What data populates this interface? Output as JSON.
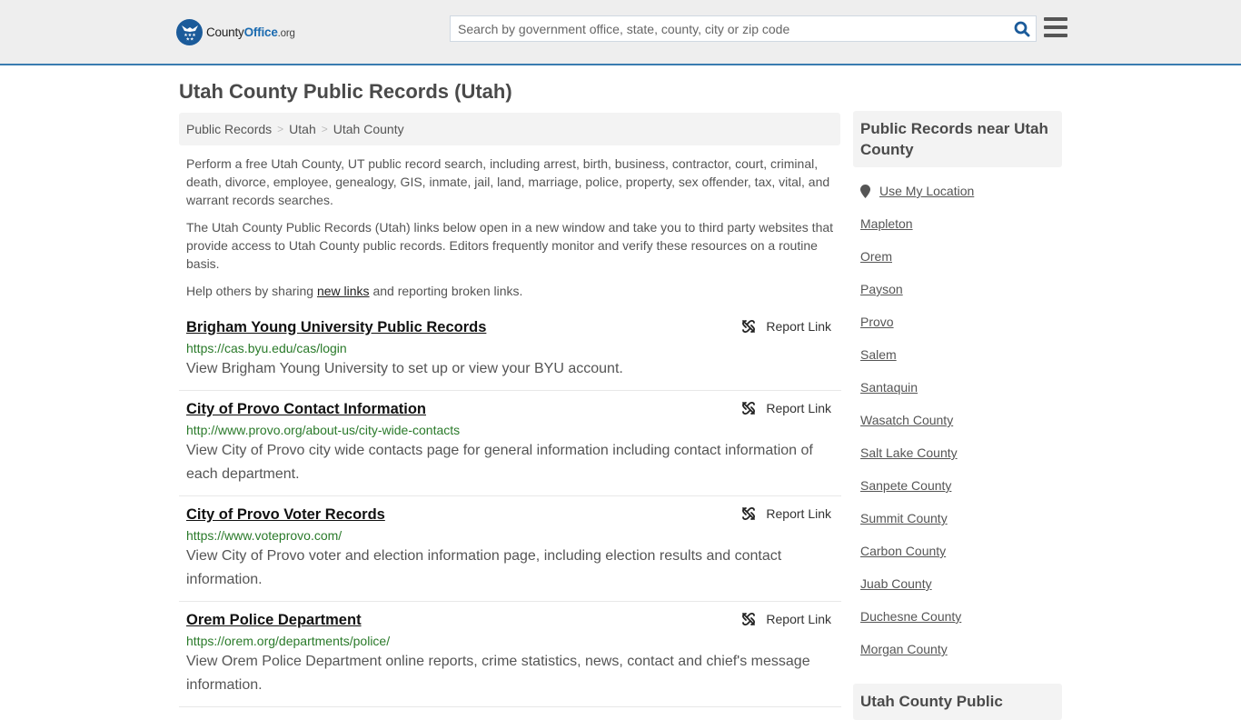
{
  "header": {
    "logo": {
      "name": "County",
      "name_bold": "Office",
      "tld": ".org"
    },
    "search": {
      "placeholder": "Search by government office, state, county, city or zip code",
      "value": ""
    },
    "icons": {
      "search": "search-icon",
      "menu": "hamburger-menu-icon"
    }
  },
  "page": {
    "title": "Utah County Public Records (Utah)"
  },
  "breadcrumb": [
    {
      "label": "Public Records"
    },
    {
      "label": "Utah"
    },
    {
      "label": "Utah County"
    }
  ],
  "intro": {
    "p1": "Perform a free Utah County, UT public record search, including arrest, birth, business, contractor, court, criminal, death, divorce, employee, genealogy, GIS, inmate, jail, land, marriage, police, property, sex offender, tax, vital, and warrant records searches.",
    "p2": "The Utah County Public Records (Utah) links below open in a new window and take you to third party websites that provide access to Utah County public records. Editors frequently monitor and verify these resources on a routine basis.",
    "p3_before": "Help others by sharing ",
    "p3_link": "new links",
    "p3_after": " and reporting broken links."
  },
  "records": [
    {
      "title": "Brigham Young University Public Records",
      "url": "https://cas.byu.edu/cas/login",
      "description": "View Brigham Young University to set up or view your BYU account.",
      "report_label": "Report Link"
    },
    {
      "title": "City of Provo Contact Information",
      "url": "http://www.provo.org/about-us/city-wide-contacts",
      "description": "View City of Provo city wide contacts page for general information including contact information of each department.",
      "report_label": "Report Link"
    },
    {
      "title": "City of Provo Voter Records",
      "url": "https://www.voteprovo.com/",
      "description": "View City of Provo voter and election information page, including election results and contact information.",
      "report_label": "Report Link"
    },
    {
      "title": "Orem Police Department",
      "url": "https://orem.org/departments/police/",
      "description": "View Orem Police Department online reports, crime statistics, news, contact and chief's message information.",
      "report_label": "Report Link"
    }
  ],
  "sidebar": {
    "heading": "Public Records near Utah County",
    "use_location": "Use My Location",
    "links": [
      "Mapleton",
      "Orem",
      "Payson",
      "Provo",
      "Salem",
      "Santaquin",
      "Wasatch County",
      "Salt Lake County",
      "Sanpete County",
      "Summit County",
      "Carbon County",
      "Juab County",
      "Duchesne County",
      "Morgan County"
    ],
    "heading2": "Utah County Public"
  },
  "colors": {
    "header_bg": "#eeeeee",
    "header_border": "#3a7cb0",
    "brand_blue": "#1b5b9a",
    "url_green": "#2a7a2a",
    "panel_bg": "#f3f3f3"
  }
}
